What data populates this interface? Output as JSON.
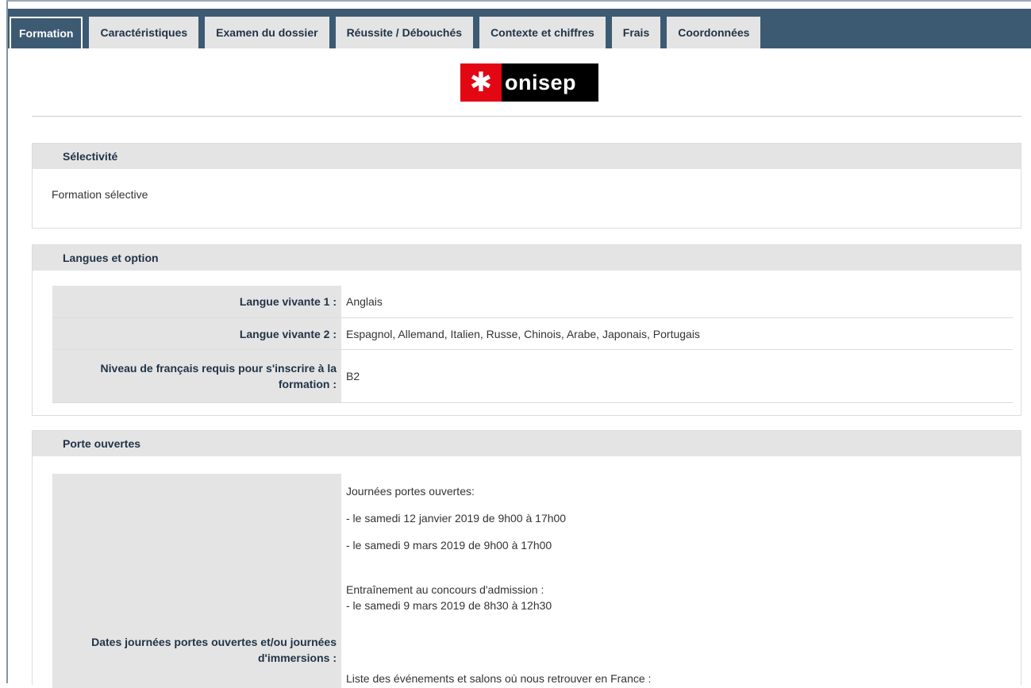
{
  "tabs": [
    {
      "label": "Formation",
      "active": true
    },
    {
      "label": "Caractéristiques",
      "active": false
    },
    {
      "label": "Examen du dossier",
      "active": false
    },
    {
      "label": "Réussite / Débouchés",
      "active": false
    },
    {
      "label": "Contexte et chiffres",
      "active": false
    },
    {
      "label": "Frais",
      "active": false
    },
    {
      "label": "Coordonnées",
      "active": false
    }
  ],
  "logo": {
    "text": "onisep",
    "mark": "✱",
    "colors": {
      "mark": "#e30613",
      "text_bg": "#000000"
    }
  },
  "selectivite": {
    "title": "Sélectivité",
    "text": "Formation sélective"
  },
  "langues": {
    "title": "Langues et option",
    "rows": [
      {
        "key": "Langue vivante 1 :",
        "value": "Anglais"
      },
      {
        "key": "Langue vivante 2 :",
        "value": "Espagnol, Allemand, Italien, Russe, Chinois, Arabe, Japonais, Portugais"
      },
      {
        "key": "Niveau de français requis pour s'inscrire à la formation :",
        "value": "B2"
      }
    ]
  },
  "portes": {
    "title": "Porte ouvertes",
    "key": "Dates journées portes ouvertes et/ou journées d'immersions :",
    "lines": {
      "jpo_title": "Journées portes ouvertes:",
      "jpo_1": "- le samedi 12 janvier 2019 de 9h00 à 17h00",
      "jpo_2": "- le samedi 9 mars 2019 de 9h00 à 17h00",
      "entrainement_title": "Entraînement au concours d'admission :",
      "entrainement_1": "- le samedi 9 mars 2019 de 8h30 à 12h30",
      "liste": "Liste des événements et salons où nous retrouver en France :"
    }
  },
  "colors": {
    "tabbar": "#3d5a73",
    "tab_inactive": "#e4e4e4",
    "header_bg": "#e4e4e4"
  }
}
